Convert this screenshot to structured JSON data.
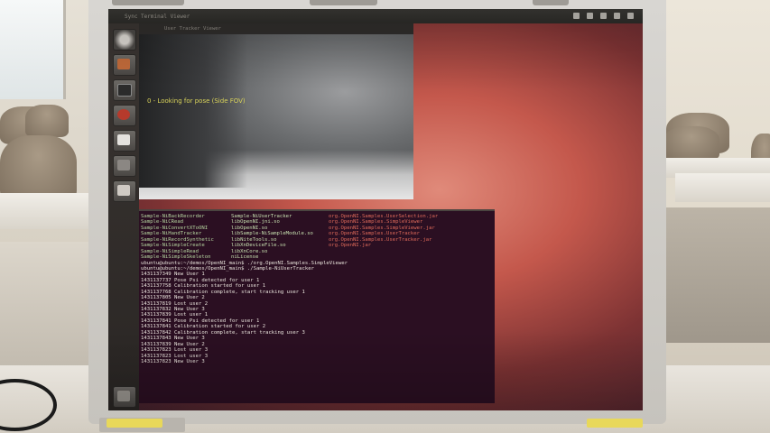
{
  "desktop": {
    "topbar_title": "Sync Terminal Viewer",
    "tray_icons": [
      "network-icon",
      "mail-icon",
      "battery-icon",
      "volume-icon",
      "clock-icon"
    ]
  },
  "launcher": {
    "items": [
      "dash-icon",
      "files-icon",
      "terminal-icon",
      "settings-icon",
      "document-icon",
      "workspace-icon",
      "drive-icon",
      "trash-icon"
    ]
  },
  "viewer": {
    "title": "User Tracker Viewer",
    "status_text": "0 - Looking for pose (Side FOV)"
  },
  "terminal": {
    "listing": [
      [
        "Sample-NiBackRecorder",
        "Sample-NiUserTracker",
        "org.OpenNI.Samples.UserSelection.jar"
      ],
      [
        "Sample-NiCRead",
        "libOpenNI.jni.so",
        "org.OpenNI.Samples.SimpleViewer"
      ],
      [
        "Sample-NiConvertXToONI",
        "libOpenNI.so",
        "org.OpenNI.Samples.SimpleViewer.jar"
      ],
      [
        "Sample-NiHandTracker",
        "libSample-NiSampleModule.so",
        "org.OpenNI.Samples.UserTracker"
      ],
      [
        "Sample-NiRecordSynthetic",
        "libNiteTools.so",
        "org.OpenNI.Samples.UserTracker.jar"
      ],
      [
        "Sample-NiSimpleCreate",
        "libXnDeviceFile.so",
        "org.OpenNI.jar"
      ],
      [
        "Sample-NiSimpleRead",
        "libXnCore.so",
        ""
      ],
      [
        "Sample-NiSimpleSkeleton",
        "niLicense",
        ""
      ]
    ],
    "commands": [
      "ubuntu@ubuntu:~/demos/OpenNI_main$ ./org.OpenNI.Samples.SimpleViewer",
      "ubuntu@ubuntu:~/demos/OpenNI_main$ ./Sample-NiUserTracker"
    ],
    "events": [
      "1431137349 New User 1",
      "1431137737 Pose Psi detected for user 1",
      "1431137758 Calibration started for user 1",
      "1431137768 Calibration complete, start tracking user 1",
      "1431137805 New User 2",
      "1431137819 Lost user 2",
      "1431137832 New User 3",
      "1431137839 Lost user 1",
      "1431137841 Pose Psi detected for user 1",
      "1431137841 Calibration started for user 2",
      "1431137842 Calibration complete, start tracking user 3",
      "1431137843 New User 3",
      "1431137839 New User 2",
      "1431137823 Lost user 3",
      "1431137823 Lost user 3",
      "1431137823 New User 3"
    ]
  }
}
